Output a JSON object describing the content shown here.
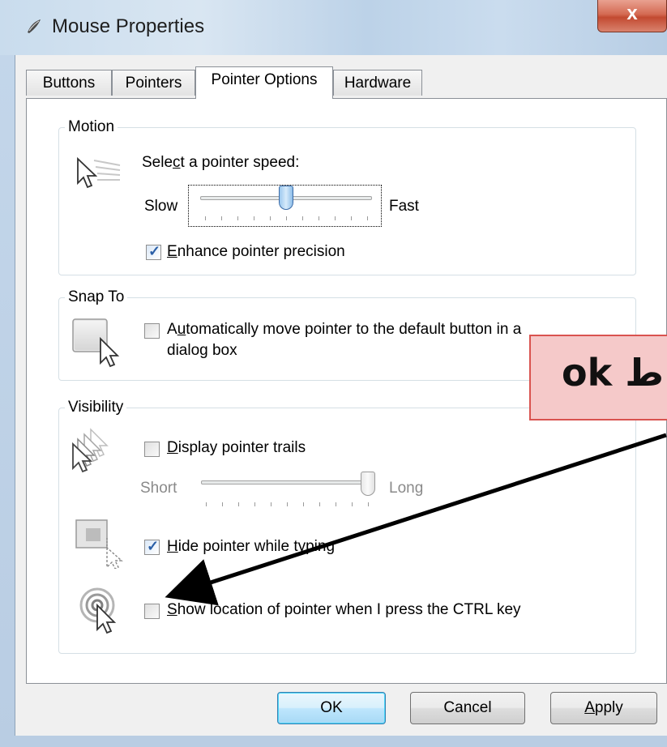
{
  "window": {
    "title": "Mouse Properties",
    "close_glyph": "x",
    "title_icon": "mouse-icon"
  },
  "tabs": [
    {
      "label": "Buttons",
      "active": false
    },
    {
      "label": "Pointers",
      "active": false
    },
    {
      "label": "Pointer Options",
      "active": true
    },
    {
      "label": "Hardware",
      "active": false
    }
  ],
  "motion": {
    "group_label": "Motion",
    "speed_label_pre": "Sele",
    "speed_label_u": "c",
    "speed_label_post": "t a pointer speed:",
    "slow": "Slow",
    "fast": "Fast",
    "speed_value": 0.5,
    "precision_u": "E",
    "precision_rest": "nhance pointer precision",
    "precision_checked": true
  },
  "snap": {
    "group_label": "Snap To",
    "line1_pre": "A",
    "line1_u": "u",
    "line1_post": "tomatically move pointer to the default button in a",
    "line2": "dialog box",
    "checked": false
  },
  "visibility": {
    "group_label": "Visibility",
    "trails_u": "D",
    "trails_rest": "isplay pointer trails",
    "trails_checked": false,
    "short": "Short",
    "long": "Long",
    "trail_value": 1.0,
    "hide_u": "H",
    "hide_rest": "ide pointer while typing",
    "hide_checked": true,
    "show_u": "S",
    "show_rest": "how location of pointer when I press the CTRL key",
    "show_checked": false
  },
  "buttons": {
    "ok": "OK",
    "cancel": "Cancel",
    "apply_u": "A",
    "apply_rest": "pply"
  },
  "annotation": {
    "text": "ok ط",
    "bg_color": "#f5c9c9",
    "border_color": "#d9534f"
  },
  "colors": {
    "accent": "#2a5fa7",
    "close_button": "#c24a31"
  }
}
